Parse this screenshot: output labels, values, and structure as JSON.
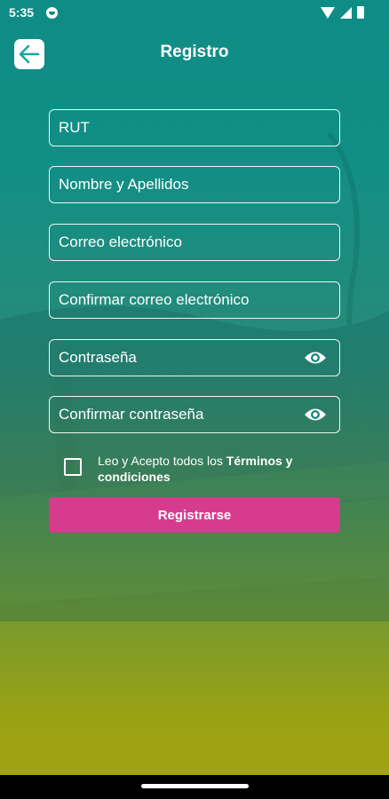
{
  "status_bar": {
    "time": "5:35"
  },
  "header": {
    "title": "Registro"
  },
  "form": {
    "rut_placeholder": "RUT",
    "name_placeholder": "Nombre y Apellidos",
    "email_placeholder": "Correo electrónico",
    "confirm_email_placeholder": "Confirmar correo electrónico",
    "password_placeholder": "Contraseña",
    "confirm_password_placeholder": "Confirmar contraseña",
    "terms_prefix": "Leo y Acepto todos los ",
    "terms_link": "Términos y condiciones",
    "terms_checked": false,
    "submit_label": "Registrarse"
  },
  "colors": {
    "accent_button": "#d73b8e",
    "gradient_top": "#0f8c85",
    "gradient_bottom": "#a4a40f"
  },
  "icons": {
    "back": "arrow-left-icon",
    "password_toggle": "eye-icon"
  }
}
